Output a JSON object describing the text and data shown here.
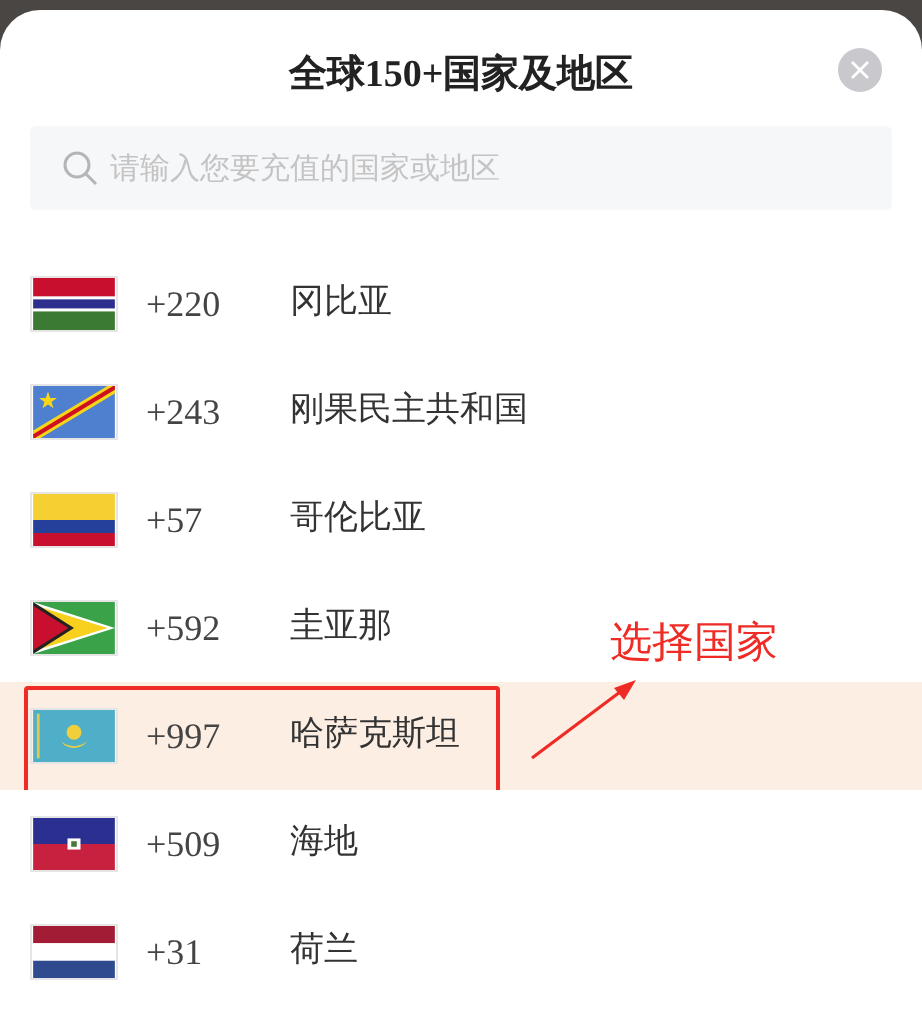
{
  "title": "全球150+国家及地区",
  "search": {
    "placeholder": "请输入您要充值的国家或地区"
  },
  "countries": [
    {
      "kind": "gambia",
      "code": "+220",
      "name": "冈比亚",
      "selected": false
    },
    {
      "kind": "congo_dr",
      "code": "+243",
      "name": "刚果民主共和国",
      "selected": false
    },
    {
      "kind": "colombia",
      "code": "+57",
      "name": "哥伦比亚",
      "selected": false
    },
    {
      "kind": "guyana",
      "code": "+592",
      "name": "圭亚那",
      "selected": false
    },
    {
      "kind": "kazakhstan",
      "code": "+997",
      "name": "哈萨克斯坦",
      "selected": true
    },
    {
      "kind": "haiti",
      "code": "+509",
      "name": "海地",
      "selected": false
    },
    {
      "kind": "netherlands",
      "code": "+31",
      "name": "荷兰",
      "selected": false
    }
  ],
  "annotation": {
    "text": "选择国家"
  }
}
